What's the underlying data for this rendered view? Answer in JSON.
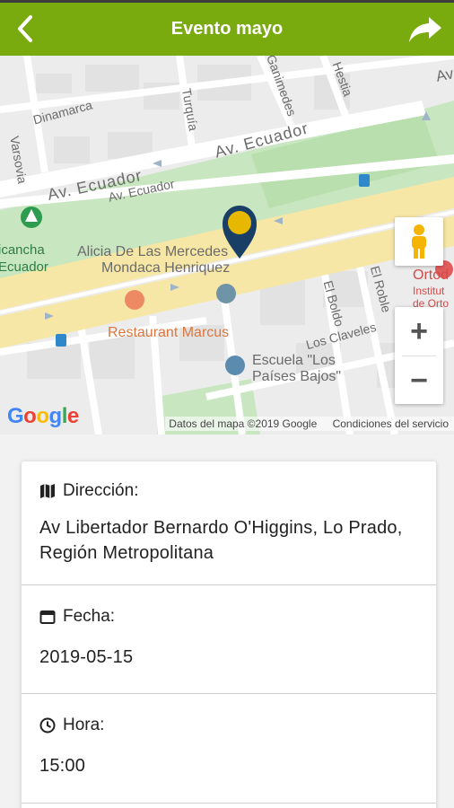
{
  "header": {
    "title": "Evento mayo",
    "back_icon": "chevron-left-icon",
    "share_icon": "share-icon",
    "background_color": "#7aab0e"
  },
  "map": {
    "labels": {
      "dinamarca": "Dinamarca",
      "varsovia": "Varsovia",
      "turquia": "Turquía",
      "ganimedes": "Ganimedes",
      "hestia": "Hestia",
      "ecuador_upper": "Av. Ecuador",
      "ecuador_lower_big": "Av. Ecuador",
      "ecuador_lower_small": "Av. Ecuador",
      "av_top": "Av",
      "cancha_1": "icancha",
      "cancha_2": "Ecuador",
      "alicia_1": "Alicia De Las Mercedes",
      "alicia_2": "Mondaca Henriquez",
      "restaurant": "Restaurant Marcus",
      "el_boldo": "El Boldo",
      "el_roble": "El Roble",
      "los_claveles": "Los Claveles",
      "escuela_1": "Escuela \"Los",
      "escuela_2": "Países Bajos\"",
      "ortod_1": "Ortod",
      "ortod_2": "Institut",
      "ortod_3": "de Orto"
    },
    "google_logo": "Google",
    "attribution": "Datos del mapa ©2019 Google",
    "terms": "Condiciones del servicio",
    "zoom_in": "+",
    "zoom_out": "−",
    "marker_color": "#e6b800",
    "marker_outline_color": "#1a3f66"
  },
  "details": {
    "address": {
      "icon": "map-icon",
      "label": "Dirección:",
      "value": "Av Libertador Bernardo O'Higgins, Lo Prado, Región Metropolitana"
    },
    "date": {
      "icon": "calendar-icon",
      "label": "Fecha:",
      "value": "2019-05-15"
    },
    "time": {
      "icon": "clock-icon",
      "label": "Hora:",
      "value": "15:00"
    }
  }
}
